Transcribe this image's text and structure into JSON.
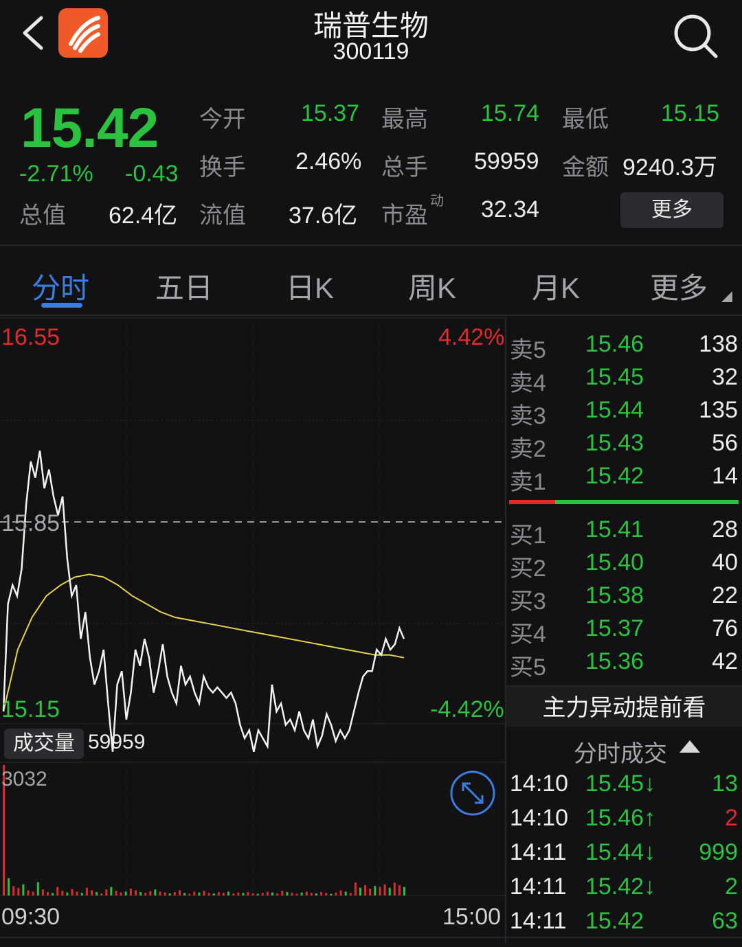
{
  "header": {
    "title": "瑞普生物",
    "code": "300119"
  },
  "quote": {
    "price": "15.42",
    "change_pct": "-2.71%",
    "change": "-0.43",
    "stats": [
      {
        "label": "今开",
        "value": "15.37",
        "color": "green"
      },
      {
        "label": "最高",
        "value": "15.74",
        "color": "green"
      },
      {
        "label": "最低",
        "value": "15.15",
        "color": "green"
      },
      {
        "label": "换手",
        "value": "2.46%",
        "color": "white"
      },
      {
        "label": "总手",
        "value": "59959",
        "color": "white"
      },
      {
        "label": "金额",
        "value": "9240.3万",
        "color": "white"
      },
      {
        "label": "流值",
        "value": "37.6亿",
        "color": "white"
      },
      {
        "label": "市盈",
        "value": "32.34",
        "color": "white"
      }
    ],
    "total_label": "总值",
    "total_value": "62.4亿",
    "pe_sup": "动",
    "more_label": "更多"
  },
  "tabs": [
    "分时",
    "五日",
    "日K",
    "周K",
    "月K",
    "更多"
  ],
  "active_tab": 0,
  "chart": {
    "y_top": "16.55",
    "y_mid": "15.85",
    "y_bottom": "15.15",
    "pct_top": "4.42%",
    "pct_bottom": "-4.42%",
    "volume_label": "成交量",
    "volume_value": "59959",
    "volume_max": "3032",
    "time_start": "09:30",
    "time_end": "15:00"
  },
  "chart_data": {
    "type": "line",
    "series": [
      {
        "values": [
          15.15,
          15.55,
          15.62,
          15.58,
          15.68,
          15.92,
          16.08,
          16.02,
          16.12,
          15.98,
          16.05,
          15.95,
          15.88,
          15.95,
          15.72,
          15.58,
          15.62,
          15.42,
          15.52,
          15.35,
          15.25,
          15.3,
          15.38,
          15.18,
          15.0,
          15.25,
          15.3,
          15.12,
          15.22,
          15.38,
          15.32,
          15.42,
          15.35,
          15.22,
          15.3,
          15.4,
          15.28,
          15.22,
          15.18,
          15.32,
          15.25,
          15.28,
          15.22,
          15.18,
          15.28,
          15.24,
          15.22,
          15.24,
          15.22,
          15.2,
          15.22,
          15.18,
          15.1,
          15.05,
          15.08,
          15.0,
          15.08,
          15.05,
          15.02,
          15.25,
          15.15,
          15.18,
          15.1,
          15.12,
          15.08,
          15.15,
          15.08,
          15.05,
          15.12,
          15.02,
          15.06,
          15.14,
          15.1,
          15.04,
          15.08,
          15.05,
          15.08,
          15.15,
          15.22,
          15.28,
          15.3,
          15.3,
          15.38,
          15.36,
          15.42,
          15.38,
          15.4,
          15.46,
          15.42
        ]
      },
      {
        "values": [
          15.15,
          15.38,
          15.5,
          15.58,
          15.62,
          15.65,
          15.66,
          15.65,
          15.62,
          15.58,
          15.55,
          15.52,
          15.5,
          15.49,
          15.48,
          15.47,
          15.46,
          15.45,
          15.44,
          15.43,
          15.42,
          15.41,
          15.4,
          15.39,
          15.38,
          15.37,
          15.36,
          15.36,
          15.35
        ]
      }
    ],
    "ylim": [
      15.15,
      16.55
    ],
    "volume": [
      3032,
      400,
      220,
      180,
      260,
      120,
      90,
      310,
      140,
      80,
      60,
      200,
      110,
      70,
      150,
      90,
      60,
      180,
      120,
      80,
      50,
      140,
      200,
      110,
      70,
      90,
      160,
      120,
      80,
      60,
      100,
      140,
      90,
      70,
      50,
      80,
      120,
      60,
      40,
      90,
      70,
      110,
      60,
      50,
      80,
      60,
      90,
      50,
      70,
      60,
      80,
      50,
      40,
      60,
      90,
      70,
      50,
      110,
      80,
      60,
      40,
      70,
      90,
      60,
      50,
      80,
      60,
      40,
      70,
      120,
      90,
      60,
      300,
      180,
      240,
      160,
      220,
      200,
      260,
      180,
      300,
      240,
      200
    ]
  },
  "order_book": {
    "sell": [
      {
        "label": "卖5",
        "price": "15.46",
        "vol": "138"
      },
      {
        "label": "卖4",
        "price": "15.45",
        "vol": "32"
      },
      {
        "label": "卖3",
        "price": "15.44",
        "vol": "135"
      },
      {
        "label": "卖2",
        "price": "15.43",
        "vol": "56"
      },
      {
        "label": "卖1",
        "price": "15.42",
        "vol": "14"
      }
    ],
    "buy": [
      {
        "label": "买1",
        "price": "15.41",
        "vol": "28"
      },
      {
        "label": "买2",
        "price": "15.40",
        "vol": "40"
      },
      {
        "label": "买3",
        "price": "15.38",
        "vol": "22"
      },
      {
        "label": "买4",
        "price": "15.37",
        "vol": "76"
      },
      {
        "label": "买5",
        "price": "15.36",
        "vol": "42"
      }
    ],
    "ratio": 0.2
  },
  "main_force_label": "主力异动提前看",
  "trades_title": "分时成交",
  "trades": [
    {
      "time": "14:10",
      "price": "15.45↓",
      "vol": "13",
      "dir": "down"
    },
    {
      "time": "14:10",
      "price": "15.46↑",
      "vol": "2",
      "dir": "up"
    },
    {
      "time": "14:11",
      "price": "15.44↓",
      "vol": "999",
      "dir": "down"
    },
    {
      "time": "14:11",
      "price": "15.42↓",
      "vol": "2",
      "dir": "down"
    },
    {
      "time": "14:11",
      "price": "15.42",
      "vol": "63",
      "dir": "down"
    }
  ],
  "colors": {
    "up": "#e32a2a",
    "down": "#2bc23f",
    "avg": "#e8d24a",
    "accent": "#3b7ee0"
  }
}
